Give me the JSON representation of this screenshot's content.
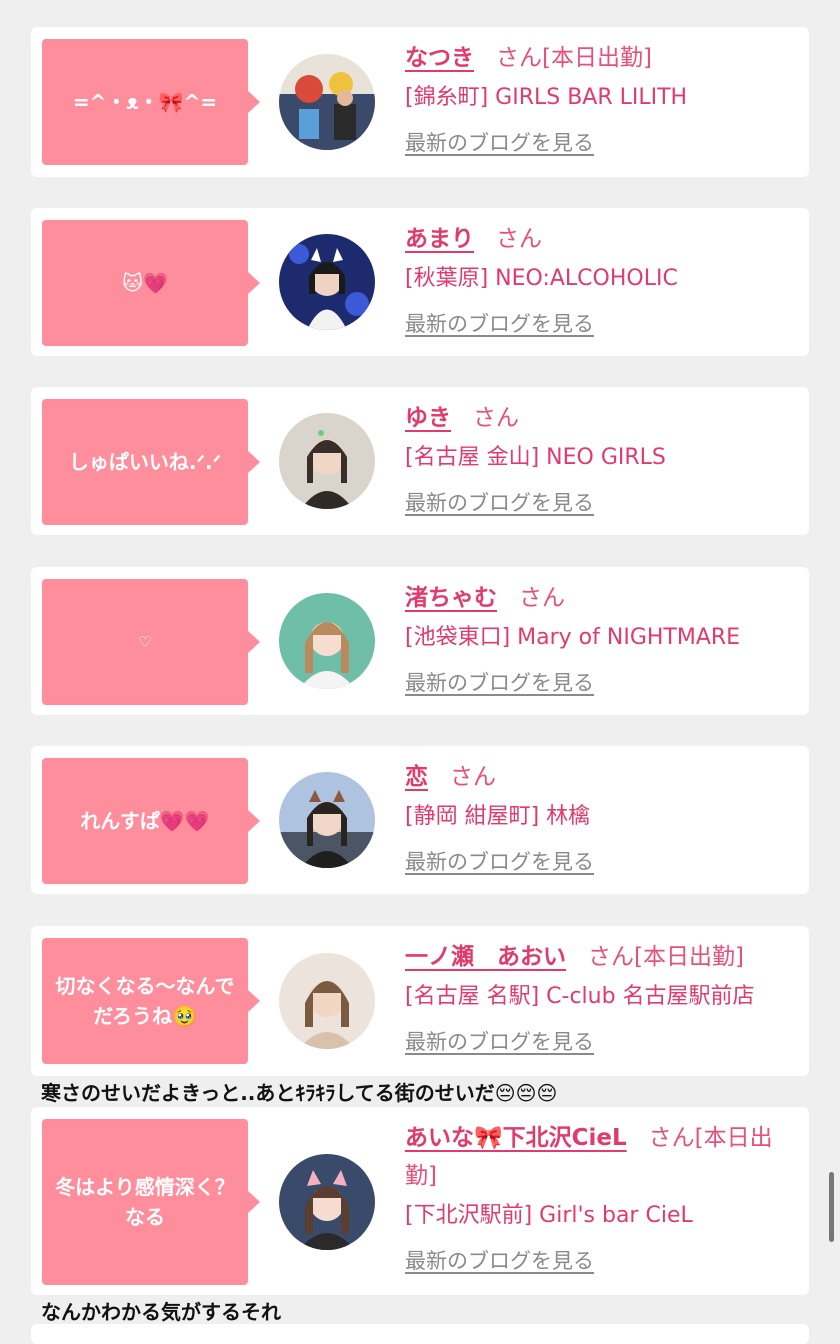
{
  "colors": {
    "background": "#efefef",
    "card": "#ffffff",
    "bubble": "#ff8e9c",
    "accent": "#e23a6c",
    "link_gray": "#8a8a8a"
  },
  "posts": [
    {
      "bubble": "=^・ᴥ・🎀^=",
      "bubble_small": false,
      "name": "なつき",
      "honorific": "さん",
      "status": "[本日出勤]",
      "shop": "[錦糸町] GIRLS BAR LILITH",
      "blog_link": "最新のブログを見る",
      "comment": ""
    },
    {
      "bubble": "🐱💗",
      "bubble_small": false,
      "name": "あまり",
      "honorific": "さん",
      "status": "",
      "shop": "[秋葉原] NEO:ALCOHOLIC",
      "blog_link": "最新のブログを見る",
      "comment": ""
    },
    {
      "bubble": "しゅぱいいね.ᐟ.ᐟ",
      "bubble_small": false,
      "name": "ゆき",
      "honorific": "さん",
      "status": "",
      "shop": "[名古屋 金山] NEO GIRLS",
      "blog_link": "最新のブログを見る",
      "comment": ""
    },
    {
      "bubble": "♡",
      "bubble_small": true,
      "name": "渚ちゃむ",
      "honorific": "さん",
      "status": "",
      "shop": "[池袋東口] Mary of NIGHTMARE",
      "blog_link": "最新のブログを見る",
      "comment": ""
    },
    {
      "bubble": "れんすぱ💗💗",
      "bubble_small": false,
      "name": "恋",
      "honorific": "さん",
      "status": "",
      "shop": "[静岡 紺屋町] 林檎",
      "blog_link": "最新のブログを見る",
      "comment": ""
    },
    {
      "bubble": "切なくなる〜なんでだろうね🥹",
      "bubble_small": false,
      "name": "一ノ瀬　あおい",
      "honorific": "さん",
      "status": "[本日出勤]",
      "shop": "[名古屋 名駅] C-club 名古屋駅前店",
      "blog_link": "最新のブログを見る",
      "comment": "寒さのせいだよきっと..あとｷﾗｷﾗしてる街のせいだ😔😔😔"
    },
    {
      "bubble": "冬はより感情深く？なる",
      "bubble_small": false,
      "name": "あいな🎀下北沢CieL",
      "honorific": "さん",
      "status": "[本日出勤]",
      "shop": "[下北沢駅前] Girl's bar CieL",
      "blog_link": "最新のブログを見る",
      "comment": "なんかわかる気がするそれ"
    }
  ]
}
